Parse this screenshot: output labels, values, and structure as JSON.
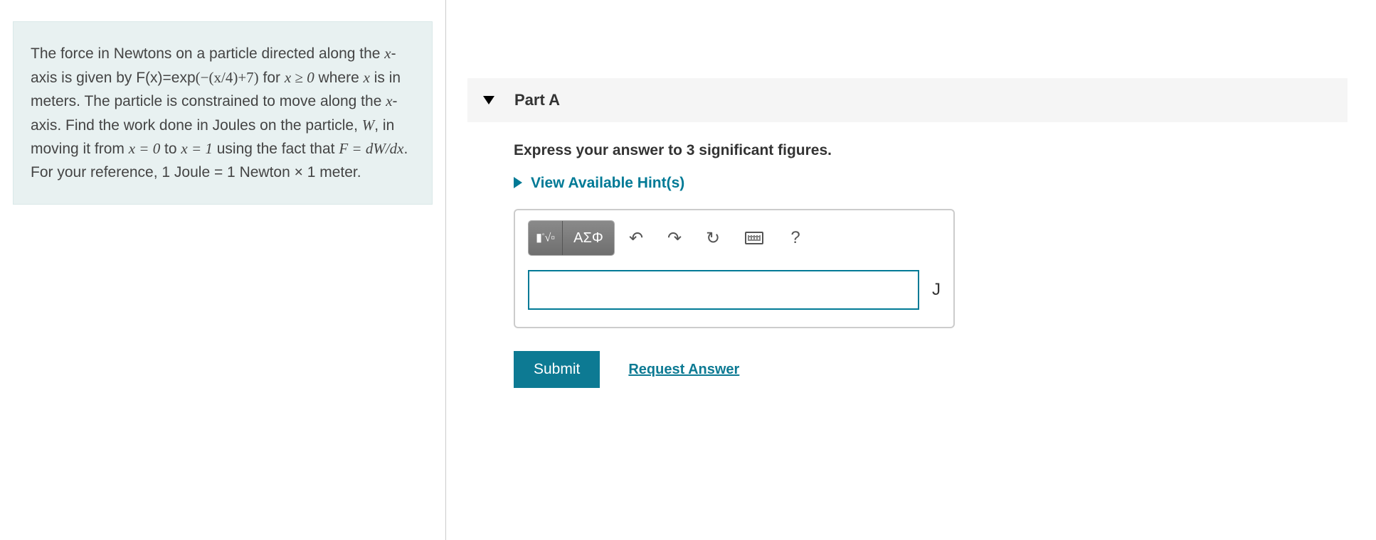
{
  "problem": {
    "line1_pre": "The force in Newtons on a particle directed along the ",
    "xaxis": "x",
    "line1_post": "-axis is given by F(x)=exp",
    "expArg": "(−(x/4)+7)",
    "line1_end": " for",
    "line2_pre": "",
    "xge0": "x ≥ 0",
    "line2_mid": " where ",
    "x2": "x",
    "line2_post": " is in meters. The particle is constrained to move along the ",
    "xaxis2": "x",
    "line3_post": "-axis. Find the work done in Joules on the particle, ",
    "W": "W",
    "line4_post": ", in moving it from ",
    "x0": "x = 0",
    "to": " to ",
    "x1": "x = 1",
    "line5_post": " using the fact that ",
    "FdW": "F = dW/dx",
    "line6": ". For your reference, 1 Joule = 1 Newton × 1 meter."
  },
  "part": {
    "title": "Part A",
    "instruction": "Express your answer to 3 significant figures.",
    "hints_label": "View Available Hint(s)"
  },
  "toolbar": {
    "greek_label": "ΑΣΦ"
  },
  "answer": {
    "value": "",
    "unit": "J"
  },
  "actions": {
    "submit": "Submit",
    "request": "Request Answer"
  }
}
